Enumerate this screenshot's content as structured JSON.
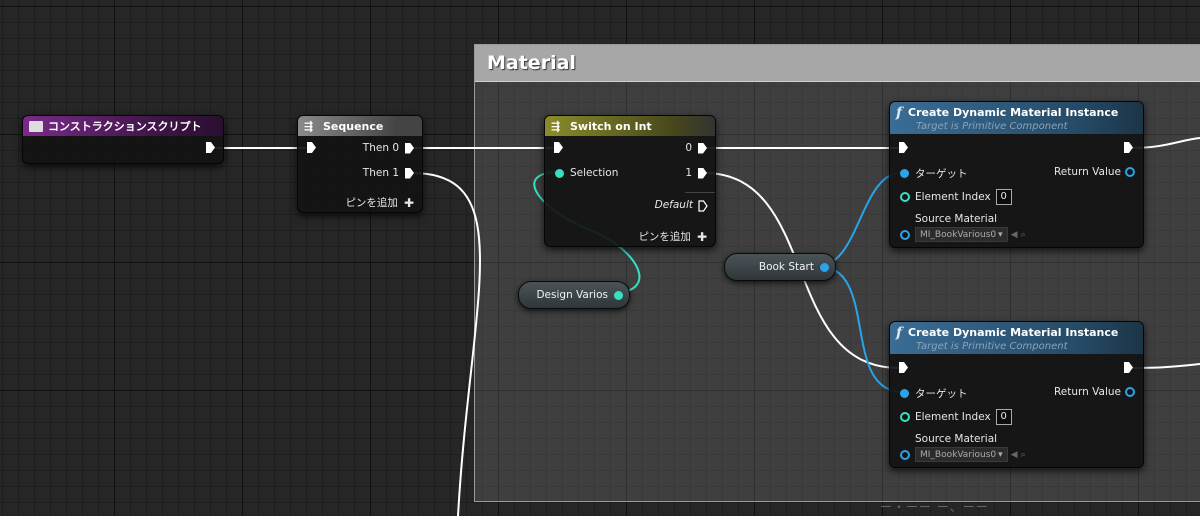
{
  "comment": {
    "title": "Material"
  },
  "watermark": "ー・ーー ー、ーー",
  "nodes": {
    "construction": {
      "title": "コンストラクションスクリプト"
    },
    "sequence": {
      "title": "Sequence",
      "then0": "Then 0",
      "then1": "Then 1",
      "add_pin": "ピンを追加"
    },
    "switch": {
      "title": "Switch on Int",
      "selection": "Selection",
      "out0": "0",
      "out1": "1",
      "default": "Default",
      "add_pin": "ピンを追加"
    },
    "cdmi1": {
      "title": "Create Dynamic Material Instance",
      "subtitle": "Target is Primitive Component",
      "target": "ターゲット",
      "return_value": "Return Value",
      "element_index_label": "Element Index",
      "element_index_value": "0",
      "source_material_label": "Source Material",
      "source_material_value": "MI_BookVarious0"
    },
    "cdmi2": {
      "title": "Create Dynamic Material Instance",
      "subtitle": "Target is Primitive Component",
      "target": "ターゲット",
      "return_value": "Return Value",
      "element_index_label": "Element Index",
      "element_index_value": "0",
      "source_material_label": "Source Material",
      "source_material_value": "MI_BookVarious0"
    }
  },
  "variables": {
    "design_varios": "Design Varios",
    "book_start": "Book Start"
  },
  "colors": {
    "exec_wire": "#ffffff",
    "int_pin": "#37e0c4",
    "object_pin": "#2aa3e8",
    "construction_header": "#7a2a8a",
    "switch_header": "#8a8c2a",
    "function_header": "#3a6d96"
  }
}
